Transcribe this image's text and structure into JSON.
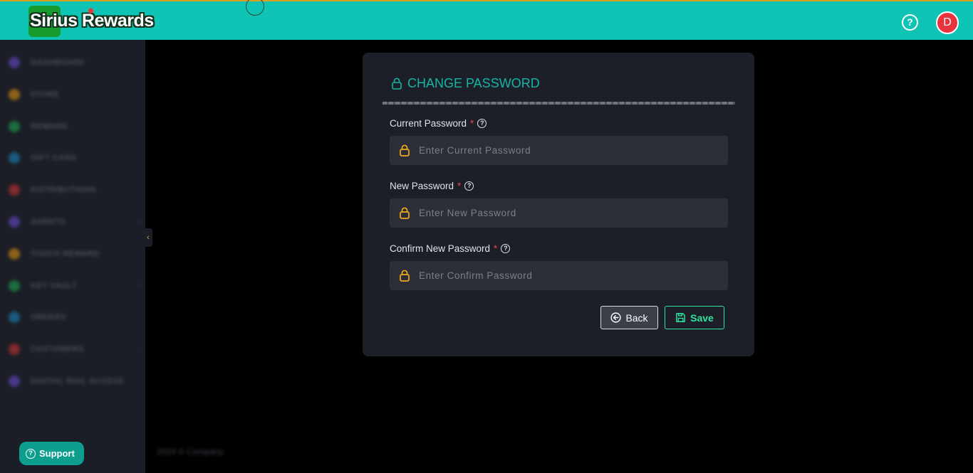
{
  "header": {
    "logo_text": "Sirius Rewards",
    "help_icon": "question-circle-icon",
    "avatar_initial": "D"
  },
  "sidebar": {
    "items": [
      {
        "label": "DASHBOARD",
        "color": "#5b3fa8"
      },
      {
        "label": "STORE",
        "color": "#b57a12"
      },
      {
        "label": "REWARD",
        "color": "#1c8a45"
      },
      {
        "label": "GIFT CARD",
        "color": "#1d6f9c"
      },
      {
        "label": "DISTRIBUTIONS",
        "color": "#a3302f"
      },
      {
        "label": "AGENTS",
        "color": "#5b3fa8",
        "has_chevron": true
      },
      {
        "label": "TOUCH REWARD",
        "color": "#b57a12"
      },
      {
        "label": "KEY VAULT",
        "color": "#1c8a45",
        "has_chevron": true
      },
      {
        "label": "ORDERS",
        "color": "#1d6f9c"
      },
      {
        "label": "CUSTOMERS",
        "color": "#a3302f",
        "has_chevron": true
      },
      {
        "label": "DIGITAL MAIL ACCESS",
        "color": "#5b3fa8"
      }
    ],
    "collapse_icon": "chevron-left-icon"
  },
  "support": {
    "label": "Support",
    "icon": "question-circle-icon"
  },
  "footer": {
    "text": "2024 © Company"
  },
  "form": {
    "title": "CHANGE PASSWORD",
    "title_icon": "lock-icon",
    "fields": [
      {
        "label": "Current Password",
        "required_mark": "*",
        "placeholder": "Enter Current Password",
        "value": ""
      },
      {
        "label": "New Password",
        "required_mark": "*",
        "placeholder": "Enter New Password",
        "value": ""
      },
      {
        "label": "Confirm New Password",
        "required_mark": "*",
        "placeholder": "Enter Confirm Password",
        "value": ""
      }
    ],
    "help_glyph": "?",
    "back_label": "Back",
    "save_label": "Save"
  },
  "colors": {
    "topbar": "#0fc4b4",
    "accent": "#16b5a3",
    "lock": "#f3a81d",
    "save": "#2ee6a0",
    "required": "#e5484d"
  }
}
